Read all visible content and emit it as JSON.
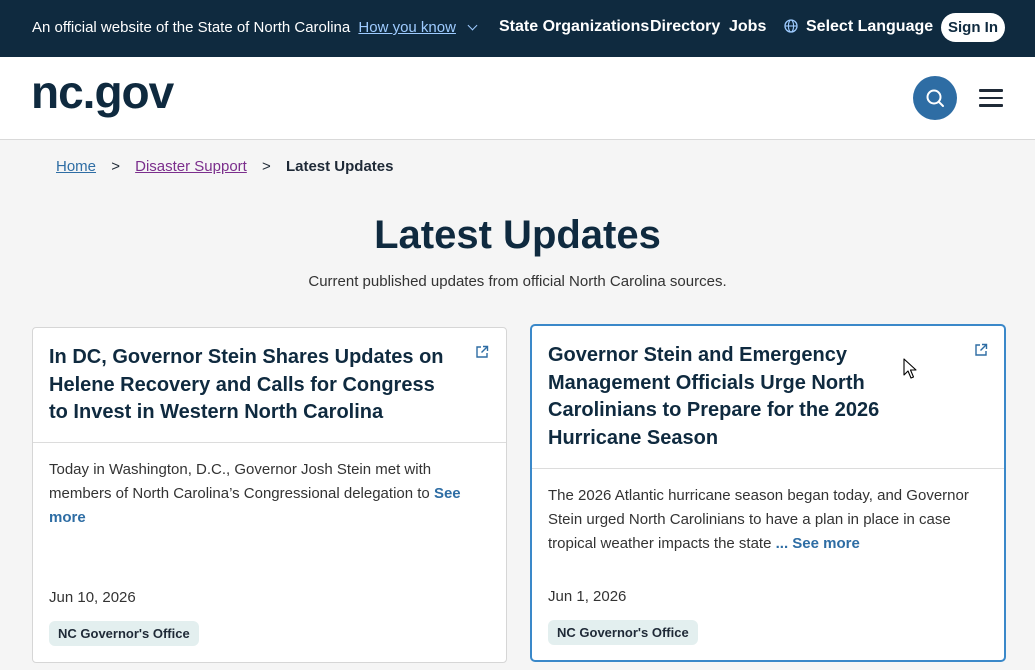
{
  "banner": {
    "official_text": "An official website of the State of North Carolina",
    "how_you_know": "How you know",
    "nav": [
      "State Organizations",
      "Directory",
      "Jobs"
    ],
    "language": "Select Language",
    "sign_in": "Sign In"
  },
  "header": {
    "logo": "nc.gov"
  },
  "breadcrumb": {
    "home": "Home",
    "separator": ">",
    "disaster": "Disaster Support",
    "current": "Latest Updates"
  },
  "page": {
    "title": "Latest Updates",
    "subtitle": "Current published updates from official North Carolina sources."
  },
  "cards": [
    {
      "title": "In DC, Governor Stein Shares Updates on Helene Recovery and Calls for Congress to Invest in Western North Carolina",
      "summary": "Today in Washington, D.C., Governor Josh Stein met with members of North Carolina’s Congressional delegation to",
      "see_more": "See more",
      "date": "Jun 10, 2026",
      "tag": "NC Governor's Office"
    },
    {
      "title": "Governor Stein and Emergency Management Officials Urge North Carolinians to Prepare for the 2026 Hurricane Season",
      "summary": "The 2026 Atlantic hurricane season began today, and Governor Stein urged North Carolinians to have a plan in place in case tropical weather impacts the state",
      "see_more": "... See more",
      "date": "Jun 1, 2026",
      "tag": "NC Governor's Office"
    }
  ],
  "colors": {
    "banner_bg": "#0f2a3f",
    "link": "#2e6da4",
    "visited_link": "#7b2e8c",
    "focus_border": "#3a88c9",
    "tag_bg": "#e3efef"
  }
}
